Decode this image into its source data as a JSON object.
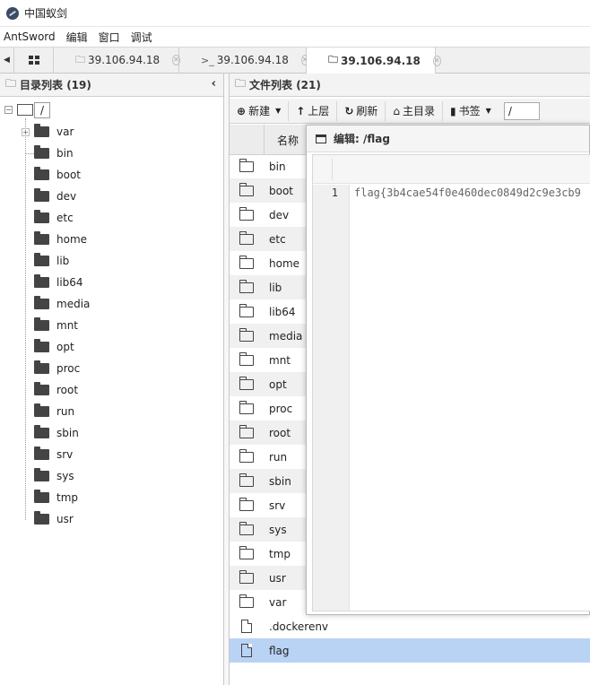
{
  "window": {
    "title": "中国蚁剑"
  },
  "menu": [
    "AntSword",
    "编辑",
    "窗口",
    "调试"
  ],
  "tabs": [
    {
      "label": "39.106.94.18",
      "icon": "folder-icon",
      "active": false
    },
    {
      "label": "39.106.94.18",
      "icon": "terminal-icon",
      "active": false
    },
    {
      "label": "39.106.94.18",
      "icon": "folder-icon",
      "active": true
    }
  ],
  "dir_panel": {
    "title": "目录列表 (19)",
    "root": "/",
    "items": [
      "var",
      "bin",
      "boot",
      "dev",
      "etc",
      "home",
      "lib",
      "lib64",
      "media",
      "mnt",
      "opt",
      "proc",
      "root",
      "run",
      "sbin",
      "srv",
      "sys",
      "tmp",
      "usr"
    ]
  },
  "file_panel": {
    "title": "文件列表 (21)",
    "toolbar": {
      "new_label": "新建",
      "up_label": "上层",
      "refresh_label": "刷新",
      "home_label": "主目录",
      "bookmark_label": "书签",
      "path_value": "/"
    },
    "column_name": "名称",
    "files": [
      {
        "name": "bin",
        "type": "folder"
      },
      {
        "name": "boot",
        "type": "folder"
      },
      {
        "name": "dev",
        "type": "folder"
      },
      {
        "name": "etc",
        "type": "folder"
      },
      {
        "name": "home",
        "type": "folder"
      },
      {
        "name": "lib",
        "type": "folder"
      },
      {
        "name": "lib64",
        "type": "folder"
      },
      {
        "name": "media",
        "type": "folder"
      },
      {
        "name": "mnt",
        "type": "folder"
      },
      {
        "name": "opt",
        "type": "folder"
      },
      {
        "name": "proc",
        "type": "folder"
      },
      {
        "name": "root",
        "type": "folder"
      },
      {
        "name": "run",
        "type": "folder"
      },
      {
        "name": "sbin",
        "type": "folder"
      },
      {
        "name": "srv",
        "type": "folder"
      },
      {
        "name": "sys",
        "type": "folder"
      },
      {
        "name": "tmp",
        "type": "folder"
      },
      {
        "name": "usr",
        "type": "folder"
      },
      {
        "name": "var",
        "type": "folder"
      },
      {
        "name": ".dockerenv",
        "type": "file"
      },
      {
        "name": "flag",
        "type": "file",
        "selected": true
      }
    ]
  },
  "editor": {
    "title": "编辑: /flag",
    "line_number": "1",
    "content": "flag{3b4cae54f0e460dec0849d2c9e3cb9"
  },
  "colors": {
    "selected_row": "#b9d3f5",
    "alt_row": "#f0f0f0"
  }
}
